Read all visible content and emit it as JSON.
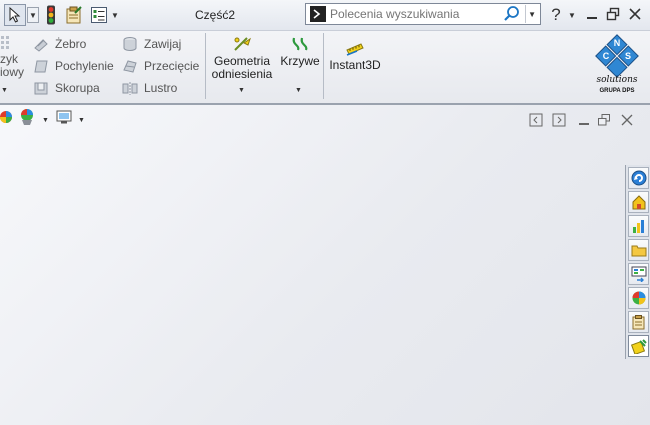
{
  "titlebar": {
    "document_title": "Część2",
    "search_placeholder": "Polecenia wyszukiwania",
    "help_label": "?"
  },
  "ribbon": {
    "partial_left_line1": "zyk",
    "partial_left_line2": "iowy",
    "col1": [
      "Żebro",
      "Pochylenie",
      "Skorupa"
    ],
    "col2": [
      "Zawijaj",
      "Przecięcie",
      "Lustro"
    ],
    "big_buttons": {
      "reference_geometry_line1": "Geometria",
      "reference_geometry_line2": "odniesienia",
      "curves": "Krzywe",
      "instant3d": "Instant3D"
    }
  },
  "logo": {
    "letters": [
      "C",
      "N",
      "S"
    ],
    "word": "solutions",
    "group": "GRUPA DPS"
  },
  "task_pane": {
    "icons": [
      "solidworks-resources-icon",
      "design-library-icon",
      "file-explorer-icon",
      "folder-icon",
      "view-palette-icon",
      "appearances-icon",
      "custom-properties-icon",
      "extra-tool-icon"
    ]
  },
  "colors": {
    "accent_blue": "#1c76c4",
    "logo_blue": "#2f87d3",
    "ribbon_bg": "#eceef2",
    "viewport_bg": "#eef0f4"
  }
}
